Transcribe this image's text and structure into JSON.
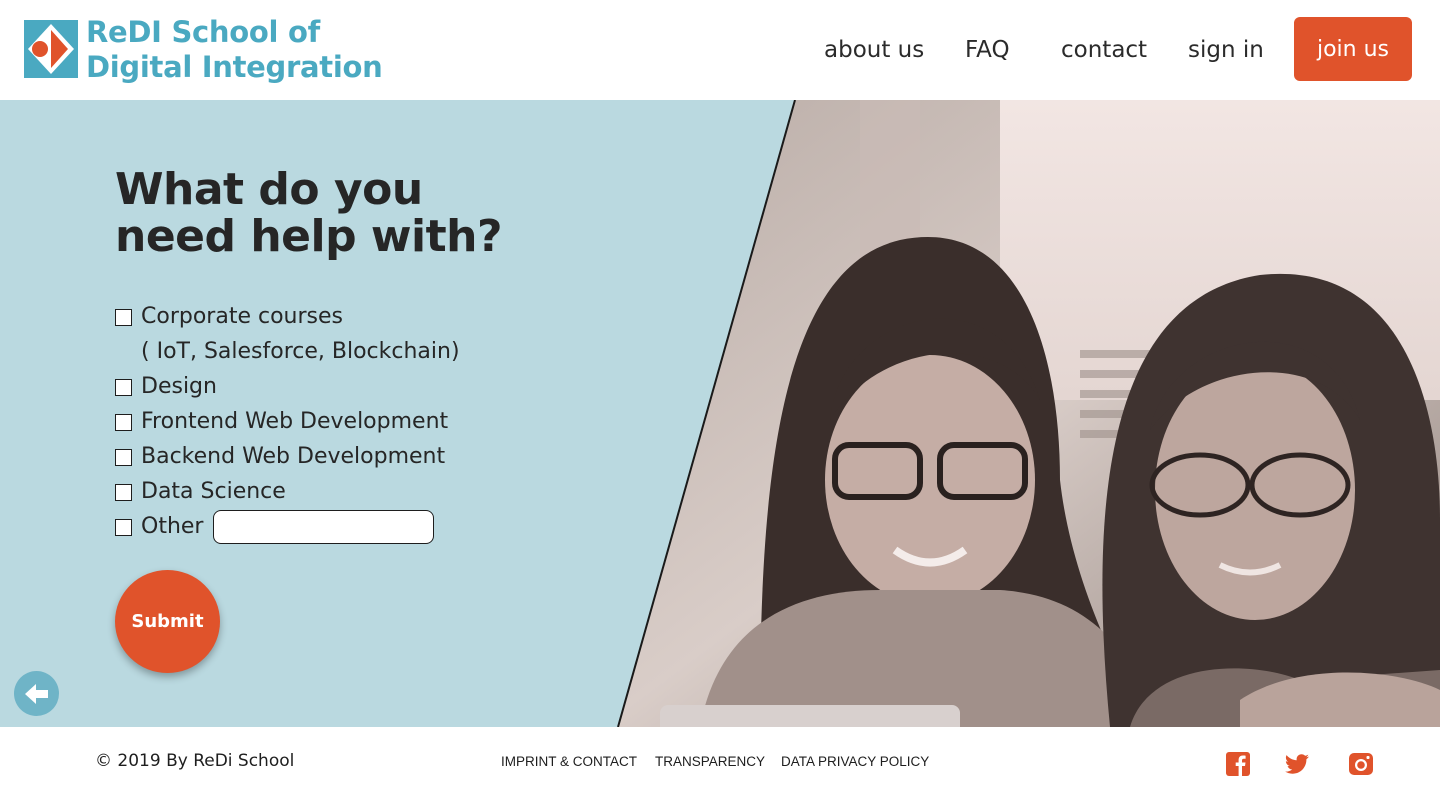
{
  "header": {
    "logo": {
      "line1": "ReDI School of",
      "line2": "Digital Integration",
      "icon": "redi-logo-icon",
      "color": "#4aa9c1",
      "accent": "#e0532b"
    },
    "nav": {
      "about": "about us",
      "faq": "FAQ",
      "contact": "contact",
      "signin": "sign in",
      "join": "join us"
    }
  },
  "main": {
    "headline_line1": "What do you",
    "headline_line2": "need help with?",
    "options": {
      "corporate": "Corporate courses",
      "corporate_sub": "( IoT, Salesforce, Blockchain)",
      "design": "Design",
      "frontend": "Frontend Web Development",
      "backend": "Backend Web Development",
      "data_science": "Data Science",
      "other": "Other"
    },
    "other_input_value": "",
    "submit": "Submit",
    "back_icon": "arrow-left-icon",
    "background": "#bad9e0"
  },
  "footer": {
    "copyright": "© 2019 By ReDi School",
    "links": {
      "imprint": "IMPRINT & CONTACT",
      "transparency": "TRANSPARENCY",
      "privacy": "DATA PRIVACY POLICY"
    },
    "social": {
      "facebook": "facebook-icon",
      "twitter": "twitter-icon",
      "instagram": "instagram-icon",
      "color": "#e0532b"
    }
  }
}
